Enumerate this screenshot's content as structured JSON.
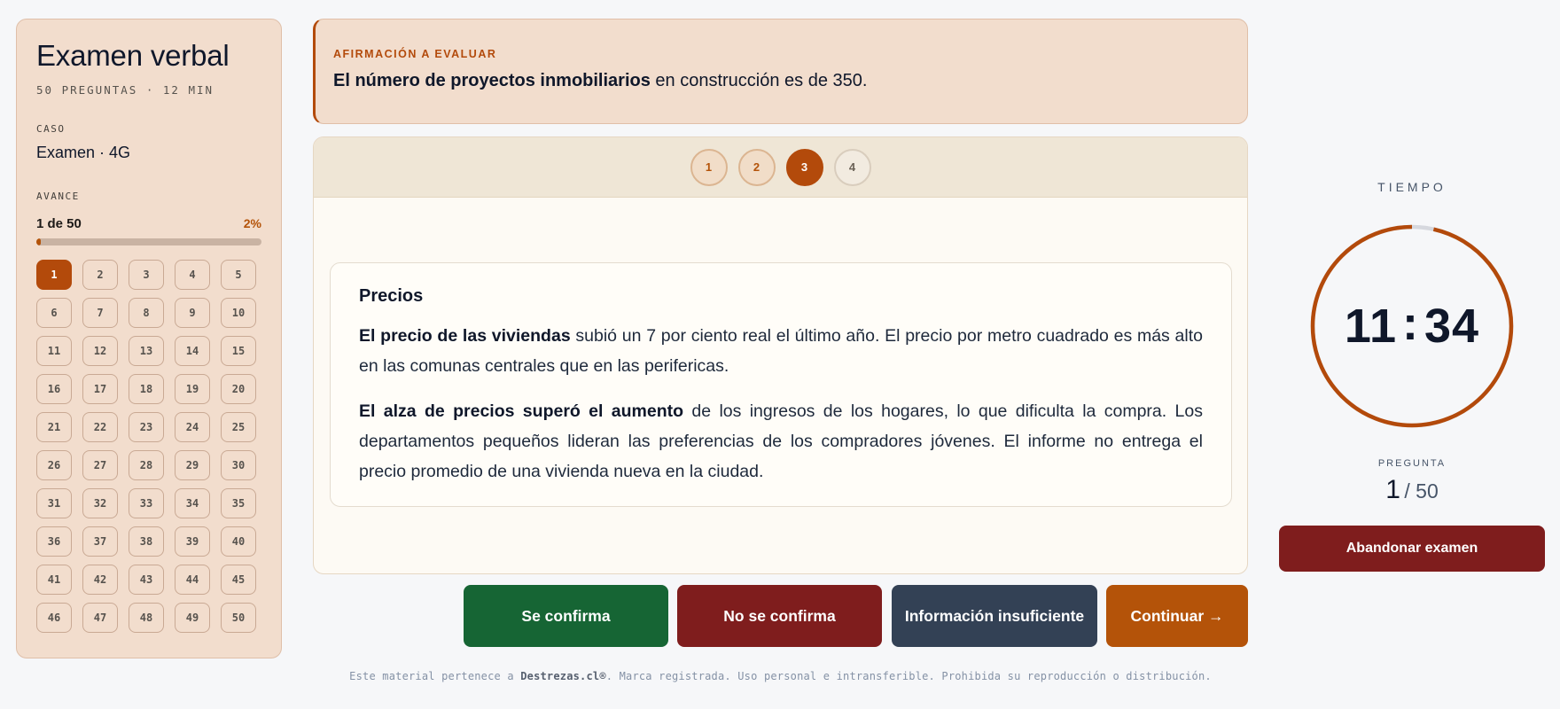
{
  "sidebar": {
    "title": "Examen verbal",
    "subtitle": "50 PREGUNTAS · 12 MIN",
    "case_label": "CASO",
    "case_value": "Examen · 4G",
    "progress_label": "AVANCE",
    "progress_count": "1 de 50",
    "progress_percent": "2%",
    "progress_fraction": 0.02,
    "questions": [
      "1",
      "2",
      "3",
      "4",
      "5",
      "6",
      "7",
      "8",
      "9",
      "10",
      "11",
      "12",
      "13",
      "14",
      "15",
      "16",
      "17",
      "18",
      "19",
      "20",
      "21",
      "22",
      "23",
      "24",
      "25",
      "26",
      "27",
      "28",
      "29",
      "30",
      "31",
      "32",
      "33",
      "34",
      "35",
      "36",
      "37",
      "38",
      "39",
      "40",
      "41",
      "42",
      "43",
      "44",
      "45",
      "46",
      "47",
      "48",
      "49",
      "50"
    ],
    "active_question": 1
  },
  "statement": {
    "label": "AFIRMACIÓN A EVALUAR",
    "bold": "El número de proyectos inmobiliarios",
    "rest": " en construcción es de 350."
  },
  "tabs": {
    "items": [
      "1",
      "2",
      "3",
      "4"
    ],
    "active": 3
  },
  "document": {
    "title": "Precios",
    "p1_bold": "El precio de las viviendas",
    "p1_rest": " subió un 7 por ciento real el último año. El precio por metro cuadrado es más alto en las comunas centrales que en las perifericas.",
    "p2_bold": "El alza de precios superó el aumento",
    "p2_rest": " de los ingresos de los hogares, lo que dificulta la compra. Los departamentos pequeños lideran las preferencias de los compradores jóvenes. El informe no entrega el precio promedio de una vivienda nueva en la ciudad."
  },
  "answers": {
    "confirm": "Se confirma",
    "not_confirm": "No se confirma",
    "insufficient": "Información insuficiente",
    "continue": "Continuar →"
  },
  "footer": {
    "prefix": "Este material pertenece a ",
    "brand": "Destrezas.cl®",
    "suffix": ". Marca registrada. Uso personal e intransferible. Prohibida su reproducción o distribución."
  },
  "timer": {
    "label": "TIEMPO",
    "minutes": "11",
    "separator": ":",
    "seconds": "34",
    "remaining_fraction": 0.965
  },
  "question_counter": {
    "label": "PREGUNTA",
    "current": "1",
    "total": "/ 50"
  },
  "abandon_label": "Abandonar examen",
  "colors": {
    "accent": "#b34a0b",
    "confirm": "#166534",
    "danger": "#7f1d1d",
    "neutral": "#334155"
  }
}
